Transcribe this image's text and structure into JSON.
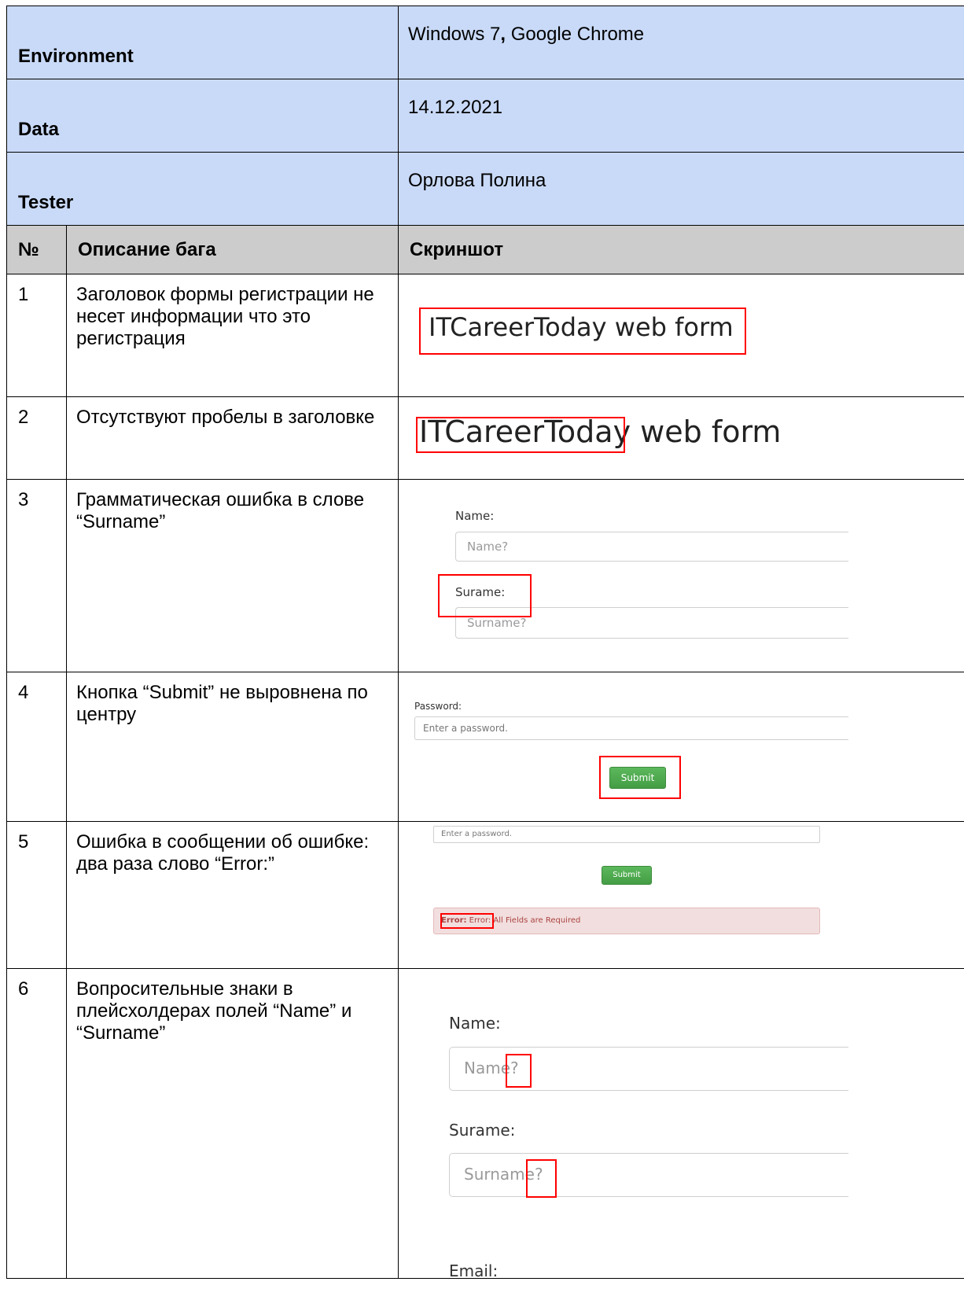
{
  "meta": {
    "environment_label": "Environment",
    "environment_value_os": "Windows 7",
    "environment_value_sep": ",",
    "environment_value_browser": " Google Chrome",
    "date_label": "Data",
    "date_value": "14.12.2021",
    "tester_label": "Tester",
    "tester_value": "Орлова Полина"
  },
  "header": {
    "num": "№",
    "description": "Описание бага",
    "screenshot": "Скриншот"
  },
  "bugs": [
    {
      "num": "1",
      "description": "Заголовок формы регистрации не несет информации что это регистрация",
      "shot": {
        "title": "ITCareerToday web form"
      }
    },
    {
      "num": "2",
      "description": "Отсутствуют пробелы в заголовке",
      "shot": {
        "title_a": "ITCareerToday",
        "title_b": " web form"
      }
    },
    {
      "num": "3",
      "description": "Грамматическая ошибка в слове “Surname”",
      "shot": {
        "name_label": "Name:",
        "name_placeholder": "Name?",
        "surname_label": "Surame:",
        "surname_placeholder": "Surname?"
      }
    },
    {
      "num": "4",
      "description": "Кнопка “Submit” не выровнена по центру",
      "shot": {
        "password_label": "Password:",
        "password_placeholder": "Enter a password.",
        "submit": "Submit"
      }
    },
    {
      "num": "5",
      "description": "Ошибка в сообщении об ошибке: два раза слово “Error:”",
      "shot": {
        "password_placeholder": "Enter a password.",
        "submit": "Submit",
        "error_bold": "Error:",
        "error_text": " Error: All Fields are Required"
      }
    },
    {
      "num": "6",
      "description": "Вопросительные знаки в плейсхолдерах полей “Name” и “Surname”",
      "shot": {
        "name_label": "Name:",
        "name_placeholder": "Name?",
        "surname_label": "Surame:",
        "surname_placeholder": "Surname?",
        "email_label": "Email:"
      }
    }
  ]
}
